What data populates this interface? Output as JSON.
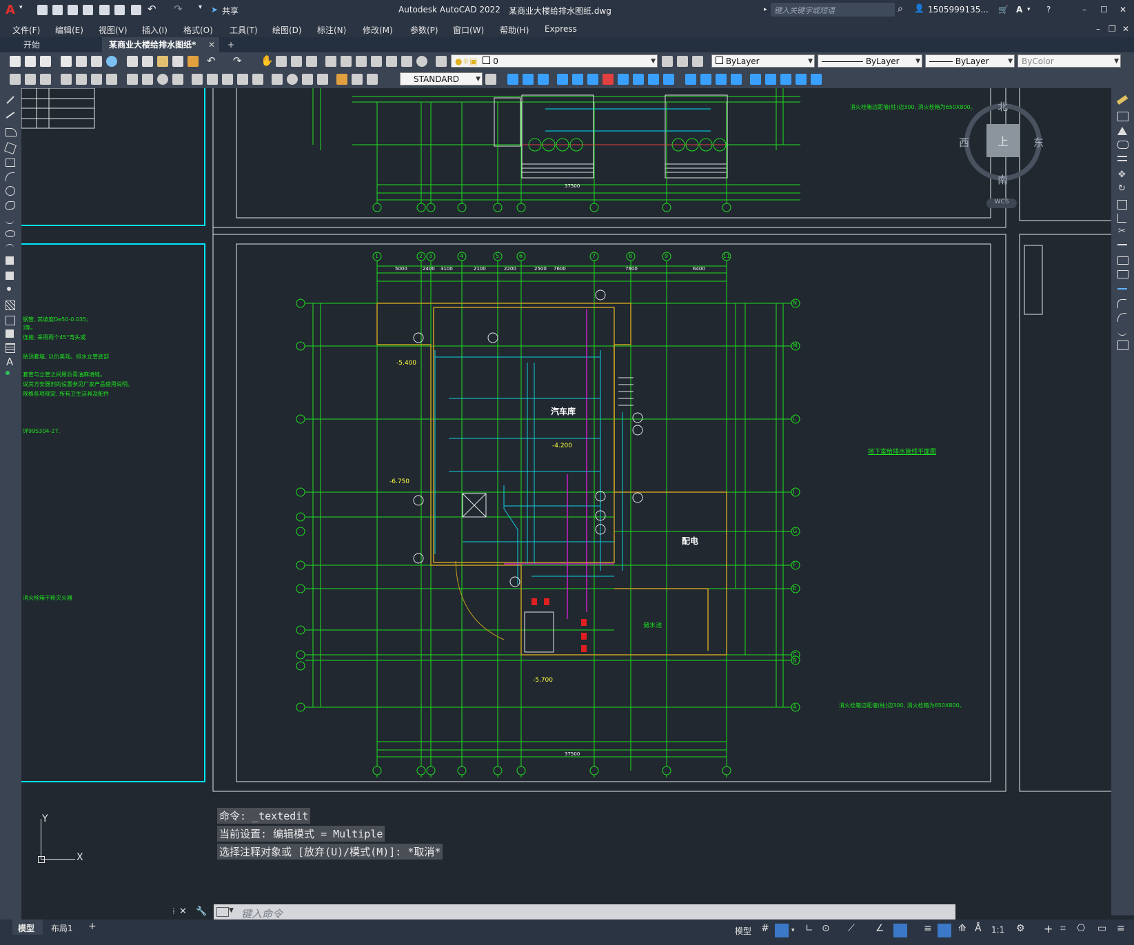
{
  "app": {
    "title": "Autodesk AutoCAD 2022",
    "file": "某商业大楼给排水图纸.dwg",
    "share_label": "共享",
    "search_placeholder": "键入关键字或短语",
    "user": "1505999135..."
  },
  "menu": [
    "文件(F)",
    "编辑(E)",
    "视图(V)",
    "插入(I)",
    "格式(O)",
    "工具(T)",
    "绘图(D)",
    "标注(N)",
    "修改(M)",
    "参数(P)",
    "窗口(W)",
    "帮助(H)",
    "Express"
  ],
  "tabs": {
    "start": "开始",
    "active": "某商业大楼给排水图纸*"
  },
  "toolbar": {
    "layer_value": "0",
    "color": "ByLayer",
    "linetype": "ByLayer",
    "lineweight": "ByLayer",
    "plotstyle": "ByColor",
    "textstyle": "STANDARD"
  },
  "viewcube": {
    "north": "北",
    "south": "南",
    "east": "东",
    "west": "西",
    "top": "上",
    "wcs": "WCS"
  },
  "drawing": {
    "label_garage": "汽车库",
    "label_power": "配电",
    "label_pool": "储水池",
    "label_elev": "-4.200",
    "label_elev2": "-5.400",
    "label_elev3": "-5.700",
    "label_elev4": "-6.750",
    "label_plan": "地下室给排水管线平面图",
    "note_right": "消火栓箱边距墙(柱)边300, 消火栓箱为650X800。",
    "note_right_bottom": "消火栓箱边距墙(柱)边300, 消火栓箱为650X800。",
    "axis_cols": [
      "1",
      "2",
      "3",
      "4",
      "5",
      "6",
      "7",
      "8",
      "9",
      "11"
    ],
    "axis_rows_right": [
      "N",
      "M",
      "L",
      "J",
      "G",
      "F",
      "E",
      "C",
      "B",
      "A"
    ],
    "axis_rows_left": [
      "N",
      "M",
      "L",
      "J",
      "H",
      "G",
      "F",
      "E",
      "D",
      "C",
      "B",
      "A"
    ],
    "dims_top": [
      "5000",
      "2400",
      "3100",
      "2100",
      "2200",
      "2500",
      "7600",
      "7600",
      "6400"
    ],
    "total_dim": "37500",
    "left_notes": [
      "钢管, 其坡度De50-0.035;",
      "]等。",
      "连接, 采用两个45°弯头或",
      "贴顶套墙, 以价美观。排水立管底部",
      "套管与立管之间用沥青油麻填缝。",
      "说其方安器剂的设置参见厂家产品使用说明。",
      "规格各项规定, 所有卫生洁具及配件",
      "详99S304-27.",
      "消火栓箱干粉灭火器"
    ]
  },
  "command": {
    "line1": "命令: _textedit",
    "line2": "当前设置: 编辑模式 = Multiple",
    "line3": "选择注释对象或 [放弃(U)/模式(M)]: *取消*",
    "placeholder": "键入命令"
  },
  "layout_tabs": [
    "模型",
    "布局1"
  ],
  "status": {
    "model": "模型",
    "scale": "1:1"
  }
}
